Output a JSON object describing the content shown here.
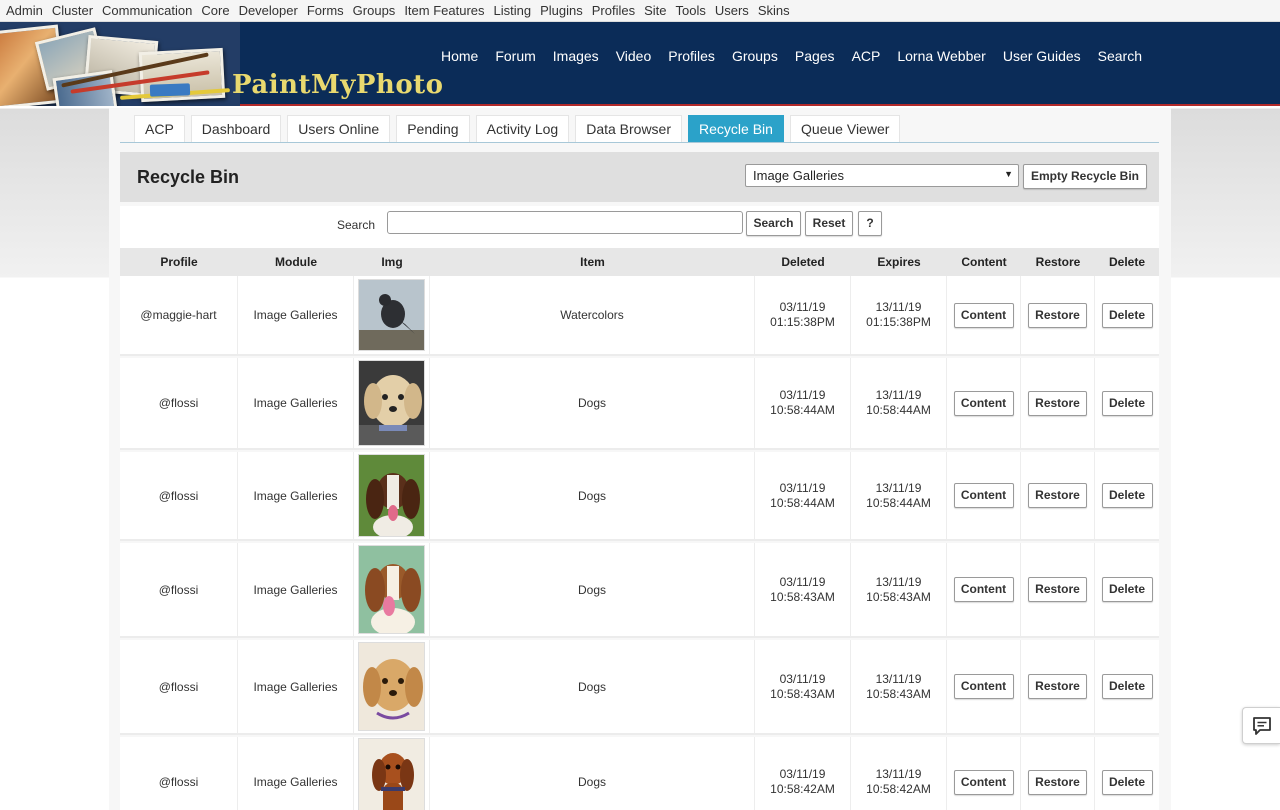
{
  "admin_menu": [
    "Admin",
    "Cluster",
    "Communication",
    "Core",
    "Developer",
    "Forms",
    "Groups",
    "Item Features",
    "Listing",
    "Plugins",
    "Profiles",
    "Site",
    "Tools",
    "Users",
    "Skins"
  ],
  "site": {
    "logo_text": "PaintMyPhoto",
    "nav": [
      "Home",
      "Forum",
      "Images",
      "Video",
      "Profiles",
      "Groups",
      "Pages",
      "ACP",
      "Lorna Webber",
      "User Guides",
      "Search"
    ]
  },
  "tabs": [
    {
      "label": "ACP",
      "active": false
    },
    {
      "label": "Dashboard",
      "active": false
    },
    {
      "label": "Users Online",
      "active": false
    },
    {
      "label": "Pending",
      "active": false
    },
    {
      "label": "Activity Log",
      "active": false
    },
    {
      "label": "Data Browser",
      "active": false
    },
    {
      "label": "Recycle Bin",
      "active": true
    },
    {
      "label": "Queue Viewer",
      "active": false
    }
  ],
  "page": {
    "title": "Recycle Bin",
    "module_select": {
      "value": "Image Galleries"
    },
    "empty_button": "Empty Recycle Bin"
  },
  "search": {
    "label": "Search",
    "value": "",
    "search_button": "Search",
    "reset_button": "Reset",
    "help_button": "?"
  },
  "table": {
    "columns": [
      "Profile",
      "Module",
      "Img",
      "Item",
      "Deleted",
      "Expires",
      "Content",
      "Restore",
      "Delete"
    ],
    "rows": [
      {
        "profile": "@maggie-hart",
        "module": "Image Galleries",
        "image": "bird-photo",
        "item": "Watercolors",
        "deleted_date": "03/11/19",
        "deleted_time": "01:15:38PM",
        "expires_date": "13/11/19",
        "expires_time": "01:15:38PM",
        "content_label": "Content",
        "restore_label": "Restore",
        "delete_label": "Delete"
      },
      {
        "profile": "@flossi",
        "module": "Image Galleries",
        "image": "cream-dog-photo",
        "item": "Dogs",
        "deleted_date": "03/11/19",
        "deleted_time": "10:58:44AM",
        "expires_date": "13/11/19",
        "expires_time": "10:58:44AM",
        "content_label": "Content",
        "restore_label": "Restore",
        "delete_label": "Delete"
      },
      {
        "profile": "@flossi",
        "module": "Image Galleries",
        "image": "spaniel-photo",
        "item": "Dogs",
        "deleted_date": "03/11/19",
        "deleted_time": "10:58:44AM",
        "expires_date": "13/11/19",
        "expires_time": "10:58:44AM",
        "content_label": "Content",
        "restore_label": "Restore",
        "delete_label": "Delete"
      },
      {
        "profile": "@flossi",
        "module": "Image Galleries",
        "image": "spaniel-painting",
        "item": "Dogs",
        "deleted_date": "03/11/19",
        "deleted_time": "10:58:43AM",
        "expires_date": "13/11/19",
        "expires_time": "10:58:43AM",
        "content_label": "Content",
        "restore_label": "Restore",
        "delete_label": "Delete"
      },
      {
        "profile": "@flossi",
        "module": "Image Galleries",
        "image": "cream-dog-painting",
        "item": "Dogs",
        "deleted_date": "03/11/19",
        "deleted_time": "10:58:43AM",
        "expires_date": "13/11/19",
        "expires_time": "10:58:43AM",
        "content_label": "Content",
        "restore_label": "Restore",
        "delete_label": "Delete"
      },
      {
        "profile": "@flossi",
        "module": "Image Galleries",
        "image": "dachshund-painting",
        "item": "Dogs",
        "deleted_date": "03/11/19",
        "deleted_time": "10:58:42AM",
        "expires_date": "13/11/19",
        "expires_time": "10:58:42AM",
        "content_label": "Content",
        "restore_label": "Restore",
        "delete_label": "Delete"
      }
    ]
  },
  "icons": {
    "chat": "speech-bubble-icon",
    "dropdown": "triangle-down-icon"
  }
}
